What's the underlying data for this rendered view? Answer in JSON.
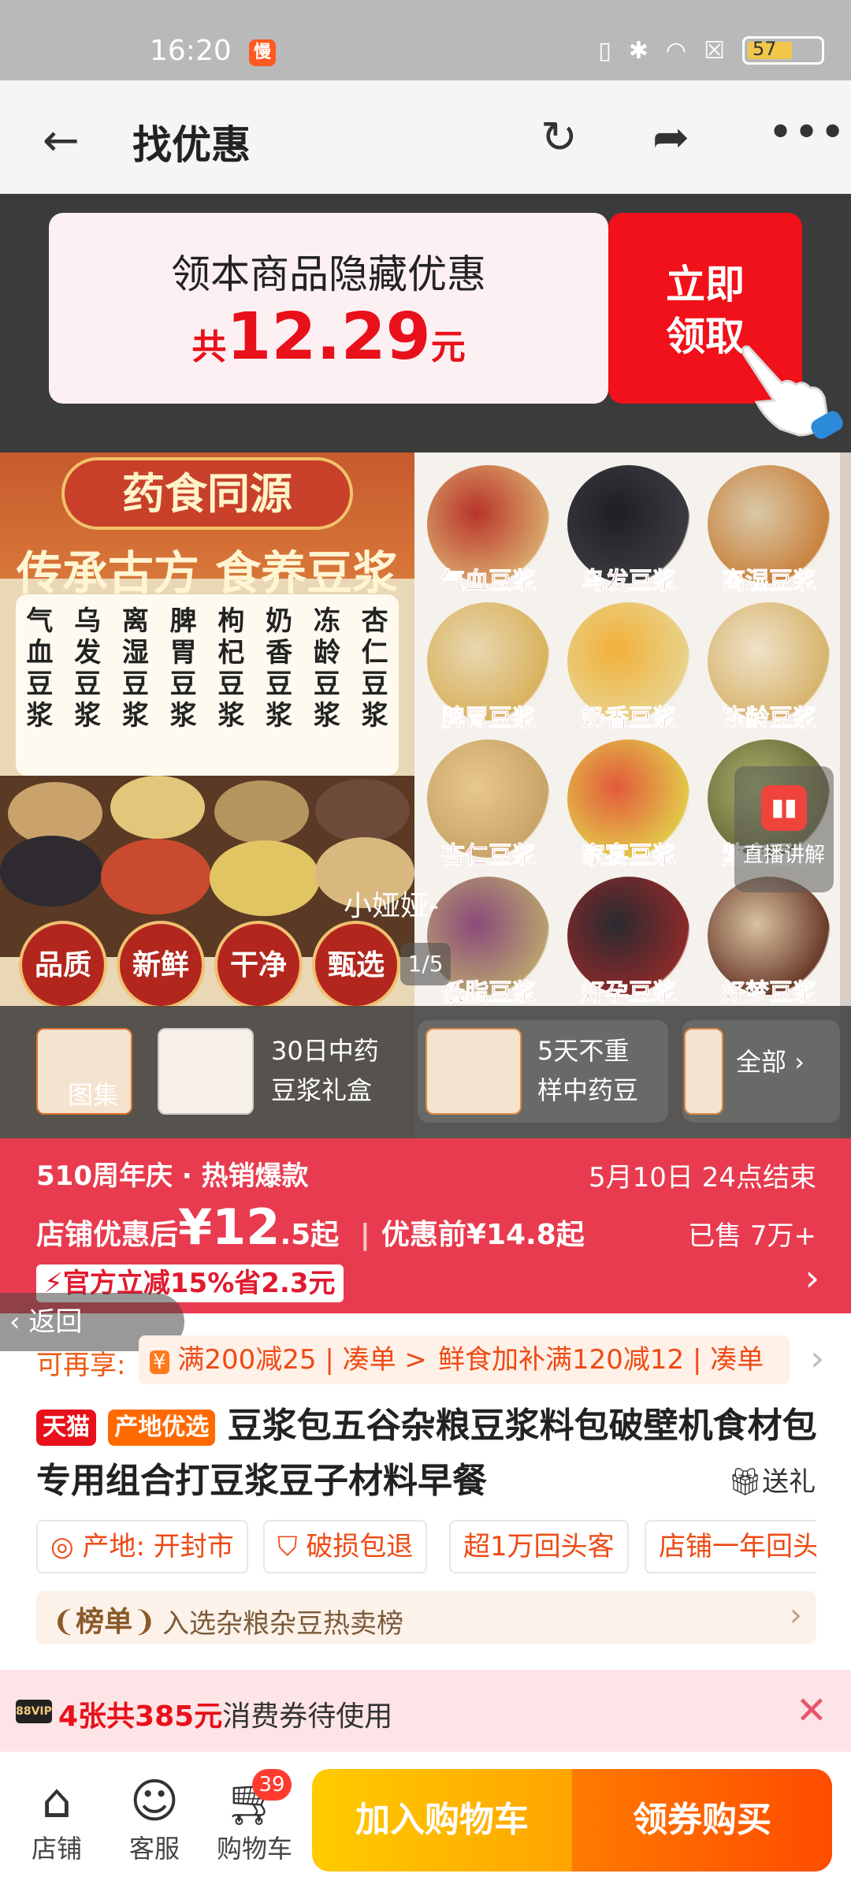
{
  "status_bar": {
    "time": "16:20",
    "app_badge": "慢",
    "battery": "57"
  },
  "header": {
    "title": "找优惠",
    "icons": [
      "back-arrow-icon",
      "refresh-icon",
      "share-icon",
      "more-icon"
    ],
    "more_badge": "···"
  },
  "hidden_coupon": {
    "line1": "领本商品隐藏优惠",
    "prefix": "共",
    "amount": "12.29",
    "unit": "元",
    "button": [
      "立即",
      "领取"
    ]
  },
  "poster": {
    "banner": "药食同源",
    "slogan": "传承古方 食养豆浆",
    "flavors": [
      "气血豆浆",
      "乌发豆浆",
      "离湿豆浆",
      "脾胃豆浆",
      "枸杞豆浆",
      "奶香豆浆",
      "冻龄豆浆",
      "杏仁豆浆"
    ],
    "features": [
      "品质",
      "新鲜",
      "干净",
      "甄选"
    ]
  },
  "grid_labels": [
    "气血豆浆",
    "乌发豆浆",
    "离湿豆浆",
    "脾胃豆浆",
    "奶香豆浆",
    "冻龄豆浆",
    "杏仁豆浆",
    "家宴豆浆",
    "熬夜豆浆",
    "低脂豆浆",
    "好孕豆浆",
    "好梦豆浆"
  ],
  "live": {
    "label": "直播讲解",
    "icon": "live-icon"
  },
  "watermark": "小娅娅-",
  "pager": "1/5",
  "thumbs": [
    {
      "caption": "图集"
    },
    {
      "text": [
        "30日中药",
        "豆浆礼盒"
      ]
    },
    {
      "text": [
        "5天不重",
        "样中药豆"
      ]
    }
  ],
  "thumbs_all": "全部",
  "promo": {
    "event": "510周年庆 · 热销爆款",
    "ends": "5月10日 24点结束",
    "after_label": "店铺优惠后",
    "after_price": "¥12",
    "after_decimal": ".5",
    "after_suffix": "起",
    "before": "优惠前¥14.8起",
    "sold": "已售 7万+",
    "tag": "官方立减15%省2.3元"
  },
  "return_button": "返回",
  "more_coupons": {
    "label": "可再享:",
    "chips": [
      "满200减25 | 凑单 >",
      "鲜食加补满120减12 | 凑单"
    ]
  },
  "title": {
    "badges": [
      "天猫",
      "产地优选"
    ],
    "text": "豆浆包五谷杂粮豆浆料包破壁机食材包专用组合打豆浆豆子材料早餐",
    "gift": "送礼"
  },
  "tags": [
    "产地: 开封市",
    "破损包退",
    "超1万回头客",
    "店铺一年回头"
  ],
  "rank": {
    "badge": "榜单",
    "text": "入选杂粮杂豆热卖榜"
  },
  "voucher": {
    "vip": "88VIP",
    "count": "4张共385元",
    "text": "消费券待使用"
  },
  "bottom_nav": [
    {
      "label": "店铺",
      "icon": "store-icon"
    },
    {
      "label": "客服",
      "icon": "service-icon"
    },
    {
      "label": "购物车",
      "icon": "cart-icon"
    }
  ],
  "cart_count": "39",
  "buttons": {
    "add_cart": "加入购物车",
    "buy": "领券购买"
  },
  "colors": {
    "accent": "#ff6a00",
    "promo": "#e83b4f",
    "claim": "#f0111a",
    "price": "#e8101a"
  }
}
